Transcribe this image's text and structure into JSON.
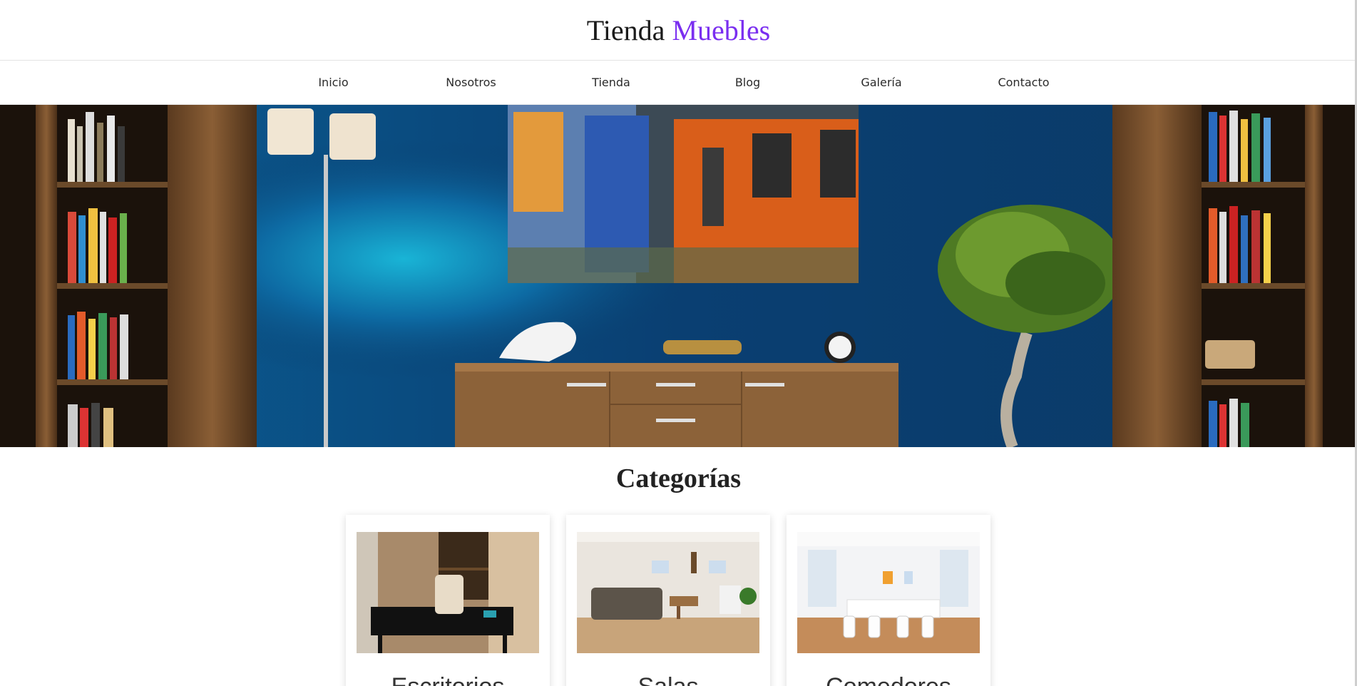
{
  "brand": {
    "name": "Tienda",
    "accent": "Muebles",
    "accent_color": "#7a2ef0"
  },
  "nav": {
    "items": [
      {
        "label": "Inicio"
      },
      {
        "label": "Nosotros"
      },
      {
        "label": "Tienda"
      },
      {
        "label": "Blog"
      },
      {
        "label": "Galería"
      },
      {
        "label": "Contacto"
      }
    ]
  },
  "hero": {
    "image": "living-room-blue-wall-photo"
  },
  "categories": {
    "title": "Categorías",
    "items": [
      {
        "label": "Escritorios",
        "image": "desk-photo"
      },
      {
        "label": "Salas",
        "image": "living-room-photo"
      },
      {
        "label": "Comedores",
        "image": "dining-room-photo"
      }
    ]
  }
}
